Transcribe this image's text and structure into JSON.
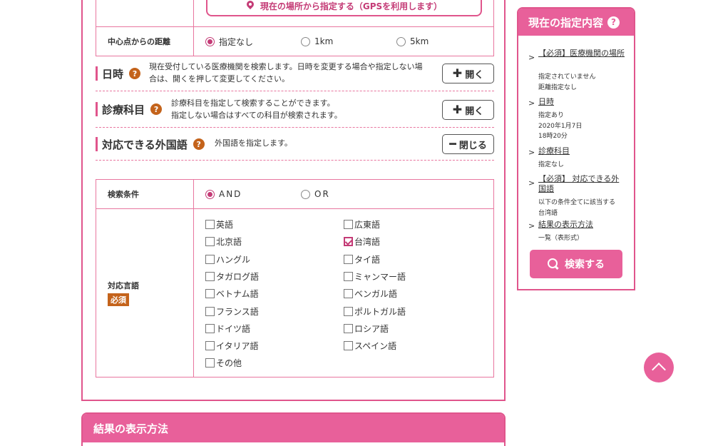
{
  "gps_button_label": "現在の場所から指定する（GPSを利用します）",
  "distance": {
    "label": "中心点からの距離",
    "options": [
      "指定なし",
      "1km",
      "5km"
    ],
    "selected": "指定なし"
  },
  "sections": {
    "datetime": {
      "title": "日時",
      "desc_line1": "現在受付している医療機関を検索します。日時を変更する場合や指定しない場",
      "desc_line2": "合は、開くを押して変更してください。",
      "button": "開く"
    },
    "department": {
      "title": "診療科目",
      "desc_line1": "診療科目を指定して検索することができます。",
      "desc_line2": "指定しない場合はすべての科目が検索されます。",
      "button": "開く"
    },
    "language": {
      "title": "対応できる外国語",
      "desc": "外国語を指定します。",
      "button": "閉じる"
    }
  },
  "search_condition": {
    "label": "検索条件",
    "options": [
      "AND",
      "OR"
    ],
    "selected": "AND"
  },
  "languages": {
    "label": "対応言語",
    "required_badge": "必須",
    "left": [
      "英語",
      "北京語",
      "ハングル",
      "タガログ語",
      "ベトナム語",
      "フランス語",
      "ドイツ語",
      "イタリア語",
      "その他"
    ],
    "right": [
      "広東語",
      "台湾語",
      "タイ語",
      "ミャンマー語",
      "ベンガル語",
      "ポルトガル語",
      "ロシア語",
      "スペイン語"
    ],
    "checked": [
      "台湾語"
    ]
  },
  "result_section_title": "結果の表示方法",
  "sidebar": {
    "title": "現在の指定内容",
    "items": [
      {
        "link": "【必須】医療機関の場所",
        "details": [
          "指定されていません",
          "距離指定なし"
        ]
      },
      {
        "link": "日時",
        "details": [
          "指定あり",
          "2020年1月7日",
          "18時20分"
        ]
      },
      {
        "link": "診療科目",
        "details": [
          "指定なし"
        ]
      },
      {
        "link": "【必須】 対応できる外国語",
        "details": [
          "以下の条件全てに該当する",
          "台湾語"
        ]
      },
      {
        "link": "結果の表示方法",
        "details": [
          "一覧（表形式）"
        ]
      }
    ],
    "search_button": "検索する"
  },
  "icons": {
    "gps": "map-pin-icon",
    "help": "question-icon",
    "open": "plus-icon",
    "close": "minus-icon",
    "search": "search-icon",
    "top": "chevron-up-icon"
  },
  "colors": {
    "accent": "#e8609a",
    "border": "#e0558c",
    "help": "#c4631b"
  }
}
